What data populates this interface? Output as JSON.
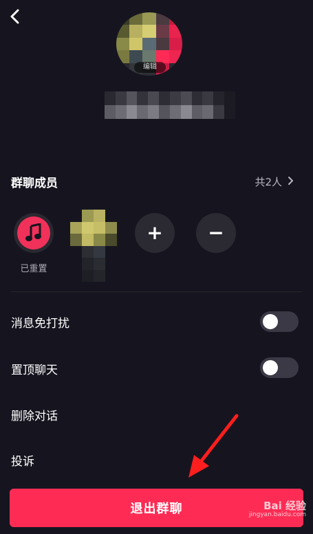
{
  "header": {
    "back_icon": "chevron-left-icon",
    "avatar_edit_label": "编辑"
  },
  "members": {
    "title": "群聊成员",
    "count_label": "共2人",
    "chevron_icon": "chevron-right-icon",
    "list": [
      {
        "name": "已重置",
        "icon": "music-note-icon"
      }
    ],
    "add_icon": "plus-icon",
    "remove_icon": "minus-icon",
    "add_label": "+",
    "remove_label": "−"
  },
  "settings": {
    "mute_label": "消息免打扰",
    "mute_on": false,
    "pin_label": "置顶聊天",
    "pin_on": false,
    "delete_label": "删除对话",
    "report_label": "投诉"
  },
  "footer": {
    "exit_label": "退出群聊"
  },
  "watermark": {
    "brand": "Bai 经验",
    "url": "jingyan.baidu.com"
  },
  "colors": {
    "background": "#16151f",
    "accent": "#fe2c55",
    "arrow": "#ff1e1e"
  }
}
